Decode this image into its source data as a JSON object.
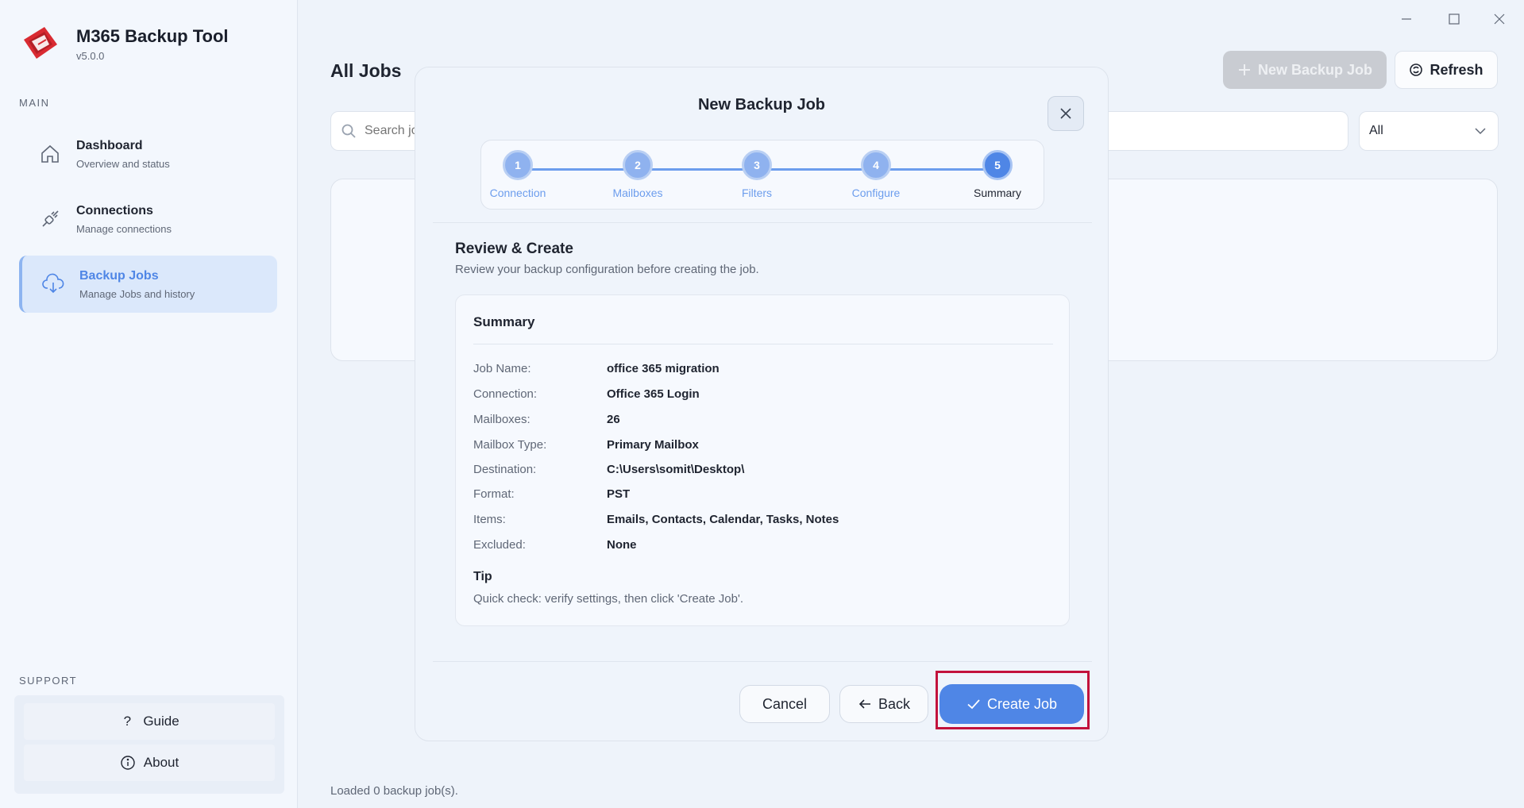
{
  "app": {
    "title": "M365 Backup Tool",
    "version": "v5.0.0"
  },
  "sidebar": {
    "main_label": "MAIN",
    "items": [
      {
        "title": "Dashboard",
        "subtitle": "Overview and status",
        "icon": "home-icon"
      },
      {
        "title": "Connections",
        "subtitle": "Manage connections",
        "icon": "plug-icon"
      },
      {
        "title": "Backup Jobs",
        "subtitle": "Manage Jobs and history",
        "icon": "cloud-download-icon",
        "active": true
      }
    ],
    "support_label": "SUPPORT",
    "support": {
      "guide": "Guide",
      "about": "About"
    }
  },
  "main": {
    "title": "All Jobs",
    "search_placeholder": "Search jobs...",
    "filter_value": "All",
    "new_job_label": "New Backup Job",
    "refresh_label": "Refresh",
    "status": "Loaded 0 backup job(s)."
  },
  "modal": {
    "title": "New Backup Job",
    "steps": [
      {
        "num": "1",
        "label": "Connection"
      },
      {
        "num": "2",
        "label": "Mailboxes"
      },
      {
        "num": "3",
        "label": "Filters"
      },
      {
        "num": "4",
        "label": "Configure"
      },
      {
        "num": "5",
        "label": "Summary",
        "current": true
      }
    ],
    "section_title": "Review & Create",
    "section_subtitle": "Review your backup configuration before creating the job.",
    "summary": {
      "title": "Summary",
      "rows": [
        {
          "key": "Job Name:",
          "value": "office 365 migration"
        },
        {
          "key": "Connection:",
          "value": "Office 365 Login"
        },
        {
          "key": "Mailboxes:",
          "value": "26"
        },
        {
          "key": "Mailbox Type:",
          "value": "Primary Mailbox"
        },
        {
          "key": "Destination:",
          "value": "C:\\Users\\somit\\Desktop\\"
        },
        {
          "key": "Format:",
          "value": "PST"
        },
        {
          "key": "Items:",
          "value": "Emails, Contacts, Calendar, Tasks, Notes"
        },
        {
          "key": "Excluded:",
          "value": "None"
        }
      ],
      "tip_title": "Tip",
      "tip_text": "Quick check: verify settings, then click 'Create Job'."
    },
    "buttons": {
      "cancel": "Cancel",
      "back": "Back",
      "create": "Create Job"
    }
  },
  "colors": {
    "accent": "#4f86e6",
    "highlight": "#c2123c",
    "brand": "#d92b32"
  }
}
